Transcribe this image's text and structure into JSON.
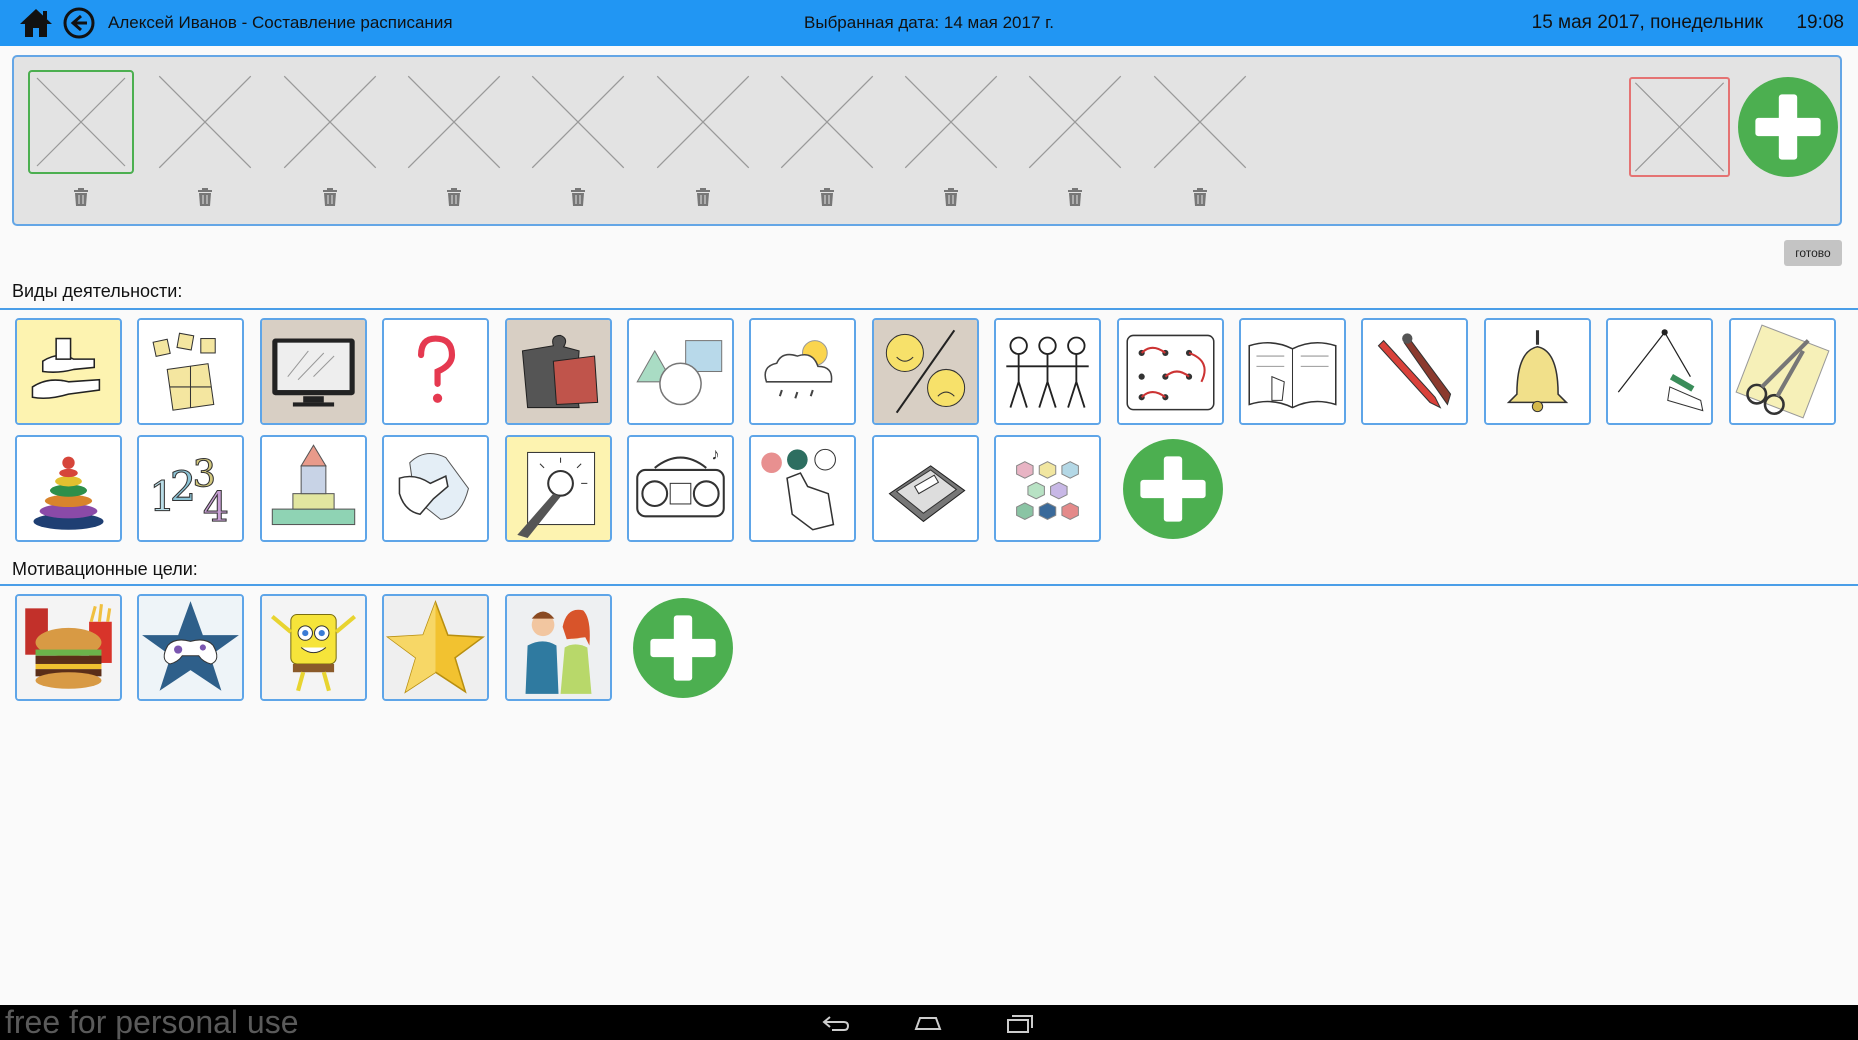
{
  "header": {
    "title": "Алексей Иванов - Составление расписания",
    "selected_date": "Выбранная дата: 14 мая 2017 г.",
    "today": "15 мая 2017, понедельник",
    "time": "19:08"
  },
  "schedule": {
    "slot_count": 10,
    "done_label": "готово"
  },
  "activities": {
    "label": "Виды деятельности:",
    "items": [
      {
        "icon": "hands-activity-icon"
      },
      {
        "icon": "letter-cubes-icon"
      },
      {
        "icon": "tv-screen-icon"
      },
      {
        "icon": "question-mark-icon"
      },
      {
        "icon": "puzzle-icon"
      },
      {
        "icon": "shapes-icon"
      },
      {
        "icon": "weather-icon"
      },
      {
        "icon": "emotions-icon"
      },
      {
        "icon": "people-group-icon"
      },
      {
        "icon": "lacing-board-icon"
      },
      {
        "icon": "book-reading-icon"
      },
      {
        "icon": "pencil-brush-icon"
      },
      {
        "icon": "bell-icon"
      },
      {
        "icon": "connect-dots-icon"
      },
      {
        "icon": "scissors-icon"
      },
      {
        "icon": "stacking-pyramid-icon"
      },
      {
        "icon": "numbers-icon"
      },
      {
        "icon": "building-blocks-icon"
      },
      {
        "icon": "wipe-cloth-icon"
      },
      {
        "icon": "light-switch-icon"
      },
      {
        "icon": "radio-music-icon"
      },
      {
        "icon": "color-touch-icon"
      },
      {
        "icon": "tablet-device-icon"
      },
      {
        "icon": "color-hexagons-icon"
      }
    ]
  },
  "motivation": {
    "label": "Мотивационные цели:",
    "items": [
      {
        "icon": "fast-food-icon"
      },
      {
        "icon": "gamepad-star-icon"
      },
      {
        "icon": "cartoon-character-icon"
      },
      {
        "icon": "gold-star-icon"
      },
      {
        "icon": "family-couple-icon"
      }
    ]
  },
  "footer": {
    "watermark": "free for personal use"
  },
  "colors": {
    "topbar": "#2196f3",
    "accent_border": "#5ea5e8",
    "add_green": "#4caf50",
    "goal_red": "#e57373"
  }
}
